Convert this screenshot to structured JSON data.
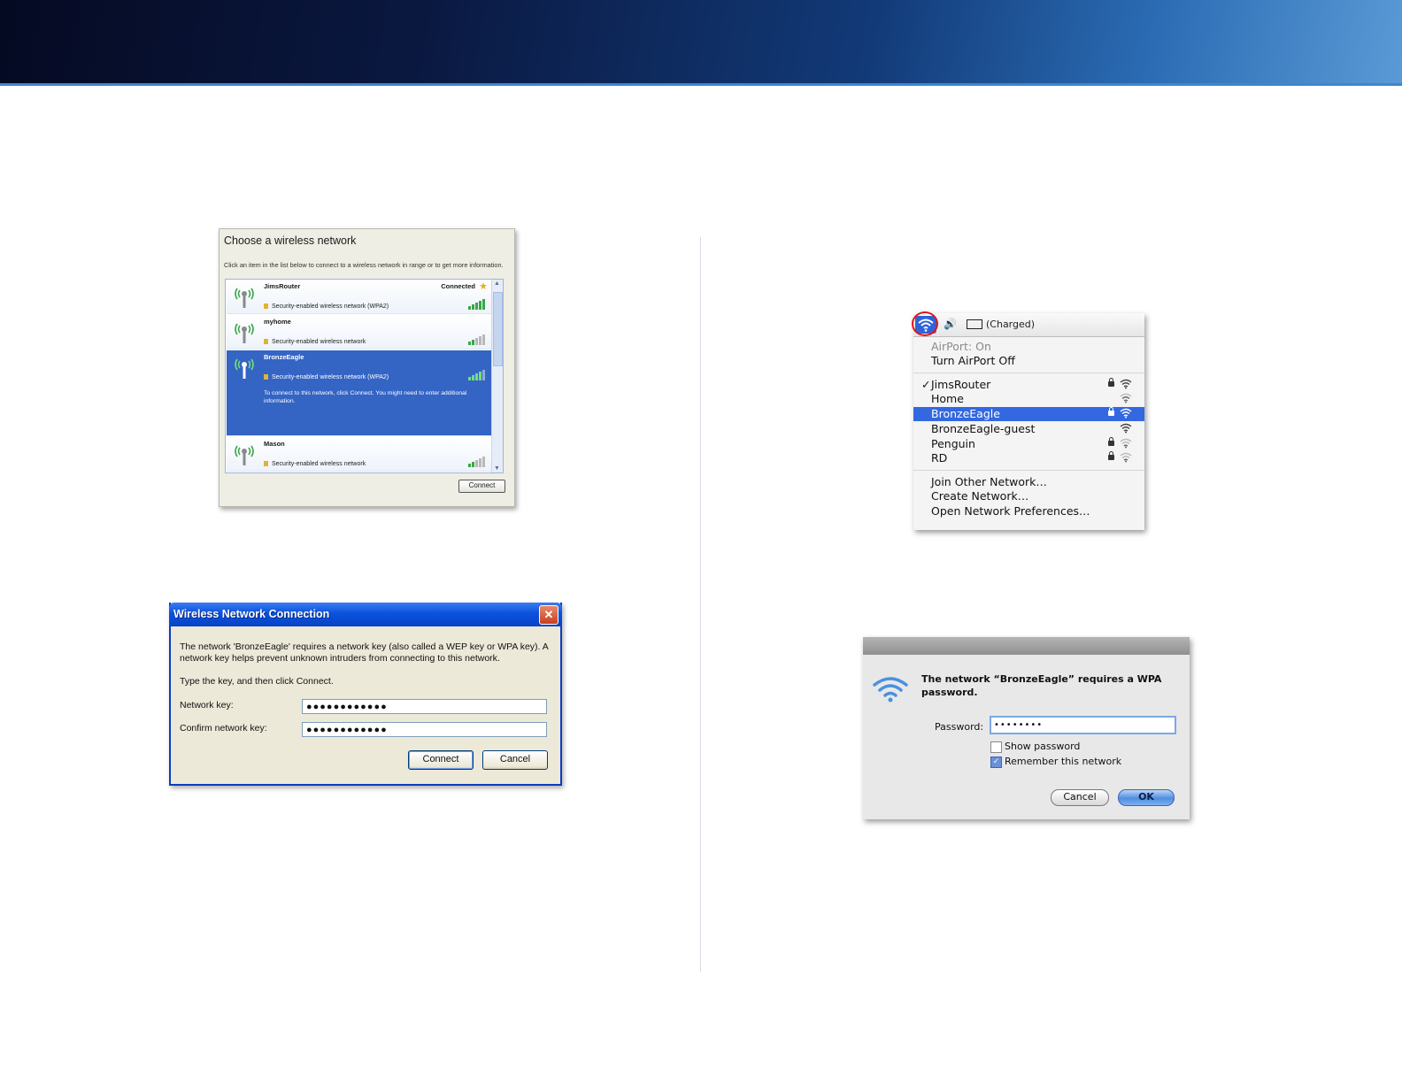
{
  "xp_choose": {
    "title": "Choose a wireless network",
    "instructions": "Click an item in the list below to connect to a wireless network in range or to get more information.",
    "networks": [
      {
        "name": "JimsRouter",
        "security": "Security-enabled wireless network (WPA2)",
        "status": "Connected"
      },
      {
        "name": "myhome",
        "security": "Security-enabled wireless network"
      },
      {
        "name": "BronzeEagle",
        "security": "Security-enabled wireless network (WPA2)",
        "note": "To connect to this network, click Connect. You might need to enter additional information."
      },
      {
        "name": "Mason",
        "security": "Security-enabled wireless network"
      }
    ],
    "connect_label": "Connect"
  },
  "xp_wnc": {
    "title": "Wireless Network Connection",
    "message": "The network 'BronzeEagle' requires a network key (also called a WEP key or WPA key). A network key helps prevent unknown intruders from connecting to this network.",
    "hint": "Type the key, and then click Connect.",
    "network_key_label": "Network key:",
    "network_key_value": "●●●●●●●●●●●●",
    "confirm_label": "Confirm network key:",
    "confirm_value": "●●●●●●●●●●●●",
    "connect_label": "Connect",
    "cancel_label": "Cancel"
  },
  "mac_menu": {
    "charged": "(Charged)",
    "airport_status": "AirPort: On",
    "turn_off": "Turn AirPort Off",
    "networks": [
      {
        "name": "JimsRouter",
        "checked": "✓"
      },
      {
        "name": "Home"
      },
      {
        "name": "BronzeEagle"
      },
      {
        "name": "BronzeEagle-guest"
      },
      {
        "name": "Penguin"
      },
      {
        "name": "RD"
      }
    ],
    "actions": [
      "Join Other Network…",
      "Create Network…",
      "Open Network Preferences…"
    ]
  },
  "mac_dialog": {
    "message": "The network “BronzeEagle” requires a WPA password.",
    "password_label": "Password:",
    "password_value": "••••••••",
    "show_password": "Show password",
    "remember": "Remember this network",
    "cancel_label": "Cancel",
    "ok_label": "OK"
  }
}
